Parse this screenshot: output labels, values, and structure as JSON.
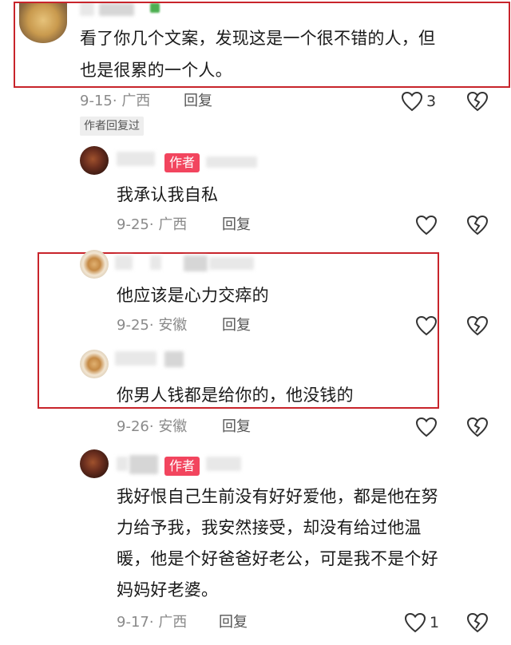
{
  "comments": [
    {
      "text_lines": [
        "看了你几个文案，发现这是一个很不错的人，但",
        "也是很累的一个人。"
      ],
      "date": "9-15",
      "location": "广西",
      "reply_label": "回复",
      "likes": "3",
      "author_replied_tag": "作者回复过"
    }
  ],
  "replies": [
    {
      "author_badge": "作者",
      "text": "我承认我自私",
      "date": "9-25",
      "location": "广西",
      "reply_label": "回复"
    },
    {
      "text": "他应该是心力交瘁的",
      "date": "9-25",
      "location": "安徽",
      "reply_label": "回复"
    },
    {
      "text": "你男人钱都是给你的，他没钱的",
      "date": "9-26",
      "location": "安徽",
      "reply_label": "回复"
    },
    {
      "author_badge": "作者",
      "text_lines": [
        "我好恨自己生前没有好好爱他，都是他在努",
        "力给予我，我安然接受，却没有给过他温",
        "暖，他是个好爸爸好老公，可是我不是个好",
        "妈妈好老婆。"
      ],
      "date": "9-17",
      "location": "广西",
      "reply_label": "回复",
      "likes": "1"
    }
  ],
  "icons": {
    "like": "heart-outline-icon",
    "dislike": "broken-heart-icon"
  },
  "colors": {
    "highlight_frame": "#c8242b",
    "author_badge": "#f2455e",
    "meta_text": "#8a8a8a"
  }
}
